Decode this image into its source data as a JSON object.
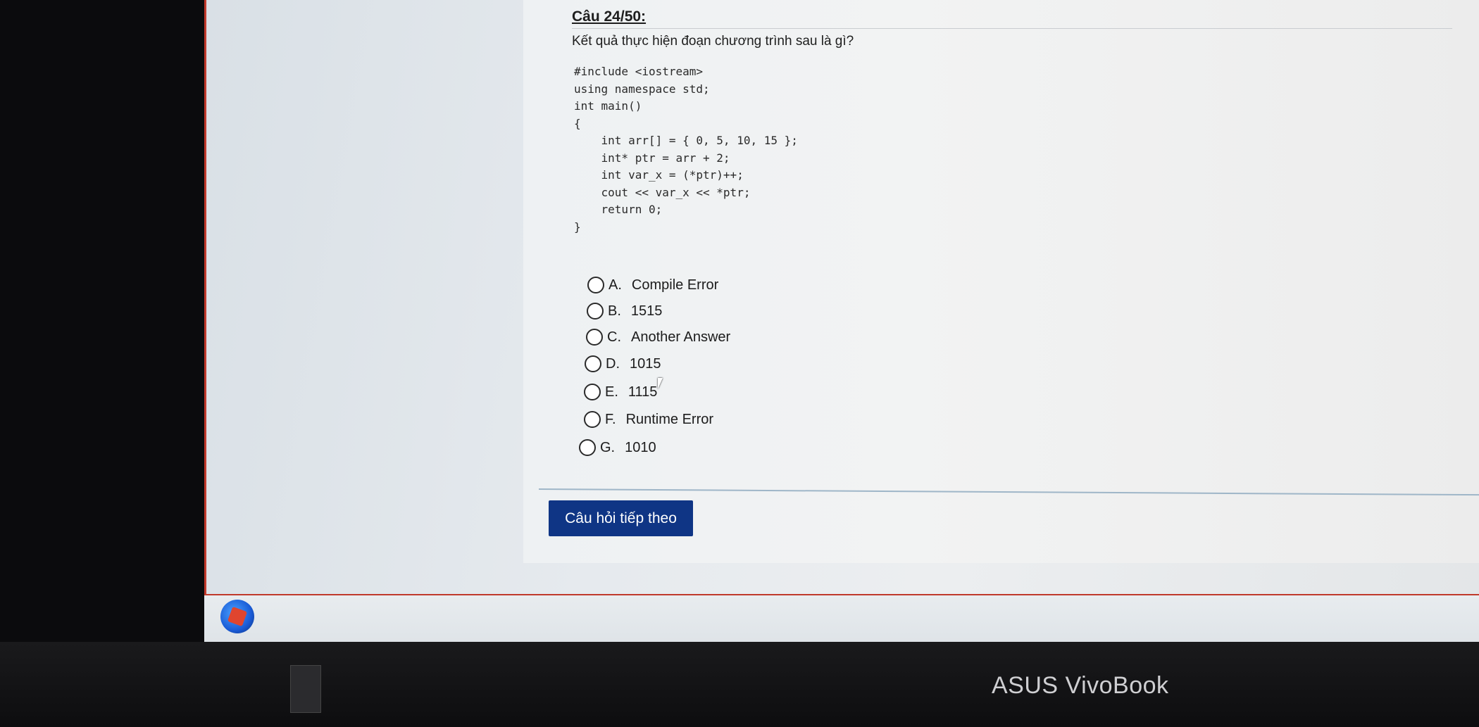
{
  "question": {
    "title": "Câu 24/50:",
    "text": "Kết quả thực hiện đoạn chương trình sau là gì?",
    "code": "#include <iostream>\nusing namespace std;\nint main()\n{\n    int arr[] = { 0, 5, 10, 15 };\n    int* ptr = arr + 2;\n    int var_x = (*ptr)++;\n    cout << var_x << *ptr;\n    return 0;\n}"
  },
  "options": [
    {
      "letter": "A.",
      "text": "Compile Error"
    },
    {
      "letter": "B.",
      "text": "1515"
    },
    {
      "letter": "C.",
      "text": "Another Answer"
    },
    {
      "letter": "D.",
      "text": "1015"
    },
    {
      "letter": "E.",
      "text": "1115"
    },
    {
      "letter": "F.",
      "text": "Runtime Error"
    },
    {
      "letter": "G.",
      "text": "1010"
    }
  ],
  "next_button": "Câu hỏi tiếp theo",
  "brand": "ASUS VivoBook",
  "icons": {
    "start": "start-orb-icon",
    "radio": "radio-icon",
    "cursor": "mouse-cursor-icon"
  }
}
